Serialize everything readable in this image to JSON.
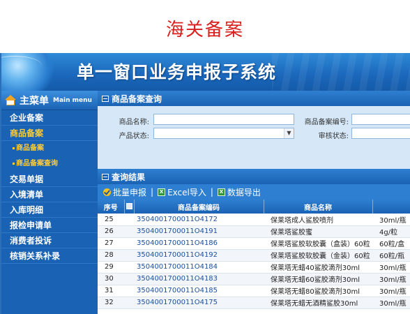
{
  "page_heading": "海关备案",
  "app": {
    "title": "单一窗口业务申报子系统"
  },
  "sidebar": {
    "main_menu_label": "主菜单",
    "main_menu_en": "Main menu",
    "items": [
      {
        "label": "企业备案"
      },
      {
        "label": "商品备案"
      },
      {
        "label": "商品备案"
      },
      {
        "label": "商品备案查询"
      },
      {
        "label": "交易单据"
      },
      {
        "label": "入境清单"
      },
      {
        "label": "入库明细"
      },
      {
        "label": "报检申请单"
      },
      {
        "label": "消费者投诉"
      },
      {
        "label": "核销关系补录"
      }
    ]
  },
  "query_panel": {
    "title": "商品备案查询",
    "fields": {
      "product_name_label": "商品名称:",
      "product_code_label": "商品备案编号:",
      "product_status_label": "产品状态:",
      "review_status_label": "审核状态:"
    }
  },
  "results_panel": {
    "title": "查询结果"
  },
  "toolbar": {
    "batch_declare": "批量申报",
    "excel_import": "Excel导入",
    "data_export": "数据导出",
    "separator": "|",
    "excel_icon_glyph": "X"
  },
  "table": {
    "columns": [
      "序号",
      "",
      "商品备案编码",
      "商品名称",
      ""
    ],
    "rows": [
      {
        "no": "25",
        "code": "3504001700011O4172",
        "name": "保莱塔成人鲨胶喷剂",
        "spec": "30ml/瓶"
      },
      {
        "no": "26",
        "code": "3504001700011O4191",
        "name": "保莱塔鲨胶蜜",
        "spec": "4g/粒"
      },
      {
        "no": "27",
        "code": "3504001700011O4186",
        "name": "保莱塔鲨胶软胶囊（盒装）60粒",
        "spec": "60粒/盒"
      },
      {
        "no": "28",
        "code": "3504001700011O4192",
        "name": "保莱塔鲨胶软胶囊（金装）60粒",
        "spec": "60粒/瓶"
      },
      {
        "no": "29",
        "code": "3504001700011O4184",
        "name": "保莱塔无蜡40鲨胶滴剂30ml",
        "spec": "30ml/瓶"
      },
      {
        "no": "30",
        "code": "3504001700011O4183",
        "name": "保莱塔无蜡60鲨胶滴剂30ml",
        "spec": "30ml/瓶"
      },
      {
        "no": "31",
        "code": "3504001700011O4185",
        "name": "保莱塔无蜡80鲨胶滴剂30ml",
        "spec": "30ml/瓶"
      },
      {
        "no": "32",
        "code": "3504001700011O4175",
        "name": "保莱塔无蜡无酒精鲨胶30ml",
        "spec": "30ml/瓶"
      }
    ]
  }
}
